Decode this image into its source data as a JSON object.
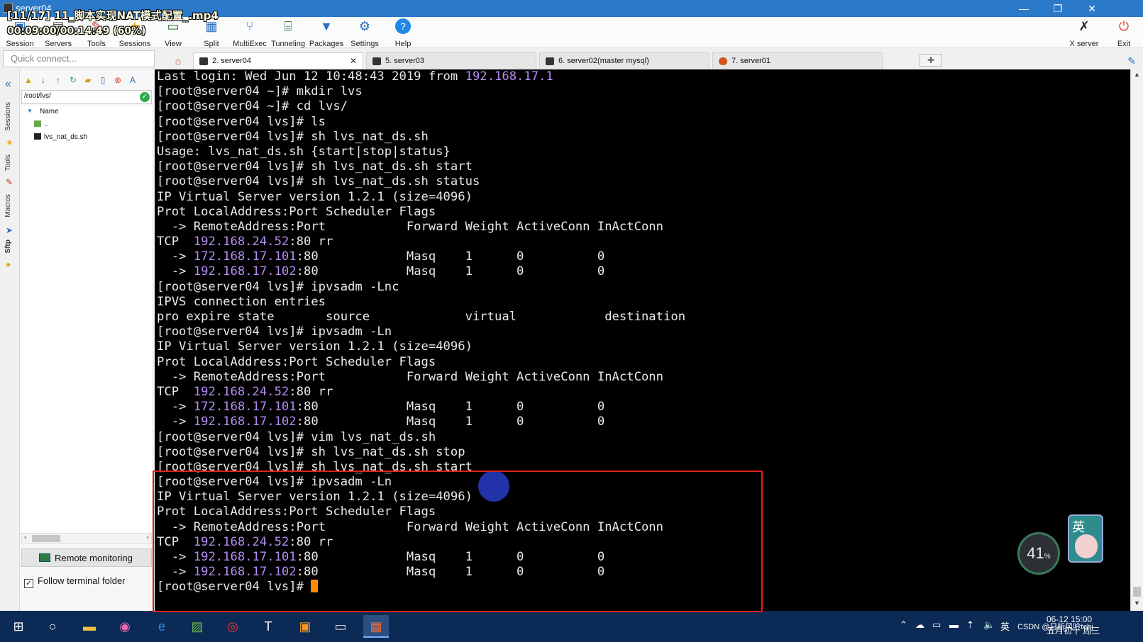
{
  "window": {
    "title": "server04",
    "minimize": "—",
    "maximize": "❐",
    "close": "✕"
  },
  "overlay": {
    "video_title": "[11/17] 11_脚本实现NAT模式配置_.mp4",
    "video_time": "00:09:00/00:14:49 (60%)"
  },
  "toolbar": {
    "items": [
      {
        "label": "Session",
        "icon": "session-icon"
      },
      {
        "label": "Servers",
        "icon": "servers-icon"
      },
      {
        "label": "Tools",
        "icon": "tools-icon"
      },
      {
        "label": "Sessions",
        "icon": "sessions-star-icon"
      },
      {
        "label": "View",
        "icon": "view-icon"
      },
      {
        "label": "Split",
        "icon": "split-icon"
      },
      {
        "label": "MultiExec",
        "icon": "multiexec-icon"
      },
      {
        "label": "Tunneling",
        "icon": "tunneling-icon"
      },
      {
        "label": "Packages",
        "icon": "packages-icon"
      },
      {
        "label": "Settings",
        "icon": "settings-icon"
      },
      {
        "label": "Help",
        "icon": "help-icon"
      }
    ],
    "xserver_label": "X server",
    "exit_label": "Exit"
  },
  "quick_connect": {
    "placeholder": "Quick connect..."
  },
  "tabs": [
    {
      "label": "2. server04",
      "active": true
    },
    {
      "label": "5. server03",
      "active": false
    },
    {
      "label": "6. server02(master mysql)",
      "active": false
    },
    {
      "label": "7. server01",
      "active": false
    }
  ],
  "side_tabs": [
    "Sessions",
    "Tools",
    "Macros",
    "Sftp"
  ],
  "sftp": {
    "path": "/root/lvs/",
    "column_name": "Name",
    "files": [
      {
        "name": ".."
      },
      {
        "name": "lvs_nat_ds.sh"
      }
    ],
    "remote_monitoring": "Remote monitoring",
    "follow_terminal": "Follow terminal folder",
    "follow_checked": true
  },
  "terminal": {
    "lines": [
      [
        {
          "t": "Last login: Wed Jun 12 10:48:43 2019 from "
        },
        {
          "t": "192.168.17.1",
          "c": "ip"
        }
      ],
      [
        {
          "t": "[root@server04 ~]# mkdir lvs"
        }
      ],
      [
        {
          "t": "[root@server04 ~]# cd lvs/"
        }
      ],
      [
        {
          "t": "[root@server04 lvs]# ls"
        }
      ],
      [
        {
          "t": "[root@server04 lvs]# sh lvs_nat_ds.sh"
        }
      ],
      [
        {
          "t": "Usage: lvs_nat_ds.sh {start|stop|status}"
        }
      ],
      [
        {
          "t": "[root@server04 lvs]# sh lvs_nat_ds.sh start"
        }
      ],
      [
        {
          "t": "[root@server04 lvs]# sh lvs_nat_ds.sh status"
        }
      ],
      [
        {
          "t": "IP Virtual Server version 1.2.1 (size=4096)"
        }
      ],
      [
        {
          "t": "Prot LocalAddress:Port Scheduler Flags"
        }
      ],
      [
        {
          "t": "  -> RemoteAddress:Port           Forward Weight ActiveConn InActConn"
        }
      ],
      [
        {
          "t": "TCP  "
        },
        {
          "t": "192.168.24.52",
          "c": "ip"
        },
        {
          "t": ":80 rr"
        }
      ],
      [
        {
          "t": "  -> "
        },
        {
          "t": "172.168.17.101",
          "c": "ip"
        },
        {
          "t": ":80            Masq    1      0          0"
        }
      ],
      [
        {
          "t": "  -> "
        },
        {
          "t": "192.168.17.102",
          "c": "ip"
        },
        {
          "t": ":80            Masq    1      0          0"
        }
      ],
      [
        {
          "t": "[root@server04 lvs]# ipvsadm -Lnc"
        }
      ],
      [
        {
          "t": "IPVS connection entries"
        }
      ],
      [
        {
          "t": "pro expire state       source             virtual            destination"
        }
      ],
      [
        {
          "t": "[root@server04 lvs]# ipvsadm -Ln"
        }
      ],
      [
        {
          "t": "IP Virtual Server version 1.2.1 (size=4096)"
        }
      ],
      [
        {
          "t": "Prot LocalAddress:Port Scheduler Flags"
        }
      ],
      [
        {
          "t": "  -> RemoteAddress:Port           Forward Weight ActiveConn InActConn"
        }
      ],
      [
        {
          "t": "TCP  "
        },
        {
          "t": "192.168.24.52",
          "c": "ip"
        },
        {
          "t": ":80 rr"
        }
      ],
      [
        {
          "t": "  -> "
        },
        {
          "t": "172.168.17.101",
          "c": "ip"
        },
        {
          "t": ":80            Masq    1      0          0"
        }
      ],
      [
        {
          "t": "  -> "
        },
        {
          "t": "192.168.17.102",
          "c": "ip"
        },
        {
          "t": ":80            Masq    1      0          0"
        }
      ],
      [
        {
          "t": "[root@server04 lvs]# vim lvs_nat_ds.sh"
        }
      ],
      [
        {
          "t": "[root@server04 lvs]# sh lvs_nat_ds.sh stop"
        }
      ],
      [
        {
          "t": "[root@server04 lvs]# sh lvs_nat_ds.sh start"
        }
      ],
      [
        {
          "t": "[root@server04 lvs]# ipvsadm -Ln"
        }
      ],
      [
        {
          "t": "IP Virtual Server version 1.2.1 (size=4096)"
        }
      ],
      [
        {
          "t": "Prot LocalAddress:Port Scheduler Flags"
        }
      ],
      [
        {
          "t": "  -> RemoteAddress:Port           Forward Weight ActiveConn InActConn"
        }
      ],
      [
        {
          "t": "TCP  "
        },
        {
          "t": "192.168.24.52",
          "c": "ip"
        },
        {
          "t": ":80 rr"
        }
      ],
      [
        {
          "t": "  -> "
        },
        {
          "t": "192.168.17.101",
          "c": "ip"
        },
        {
          "t": ":80            Masq    1      0          0"
        }
      ],
      [
        {
          "t": "  -> "
        },
        {
          "t": "192.168.17.102",
          "c": "ip"
        },
        {
          "t": ":80            Masq    1      0          0"
        }
      ],
      [
        {
          "t": "[root@server04 lvs]# "
        },
        {
          "cursor": true
        }
      ]
    ]
  },
  "widgets": {
    "gauge_value": "41",
    "gauge_unit": "%",
    "ime_char": "英"
  },
  "taskbar": {
    "clock_time": "06-12 15:00",
    "clock_date": "五月初十 周三",
    "watermark": "CSDN @日听风吟tchj",
    "lang": "英"
  },
  "colors": {
    "titlebar": "#2b79c9",
    "terminal_bg": "#000000",
    "ip_color": "#b48cf0",
    "highlight_box": "#e0201c",
    "cursor": "#ff8c00",
    "taskbar": "#0c2a56"
  }
}
